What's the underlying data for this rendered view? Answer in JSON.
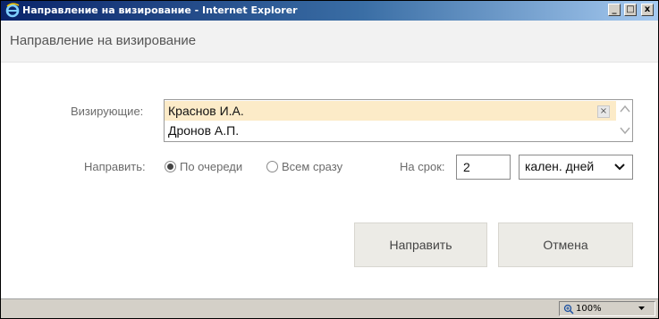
{
  "window": {
    "title": "Направление на визирование - Internet Explorer",
    "minimize": "_",
    "maximize": "□",
    "close": "x"
  },
  "dialog": {
    "header": "Направление на визирование",
    "approvers_label": "Визирующие:",
    "approvers": [
      {
        "name": "Краснов И.А.",
        "selected": true,
        "remove": "×"
      },
      {
        "name": "Дронов А.П.",
        "selected": false
      }
    ],
    "send_label": "Направить:",
    "send_options": [
      {
        "label": "По очереди",
        "checked": true
      },
      {
        "label": "Всем сразу",
        "checked": false
      }
    ],
    "term_label": "На срок:",
    "term_value": "2",
    "term_unit": "кален. дней",
    "submit_button": "Направить",
    "cancel_button": "Отмена"
  },
  "statusbar": {
    "zoom": "100%"
  },
  "icons": {
    "app": "internet-explorer-icon",
    "zoom": "zoom-icon"
  },
  "colors": {
    "selected_row": "#fcebc8",
    "button_bg": "#ecebe6",
    "title_bar": "#0a246a"
  }
}
